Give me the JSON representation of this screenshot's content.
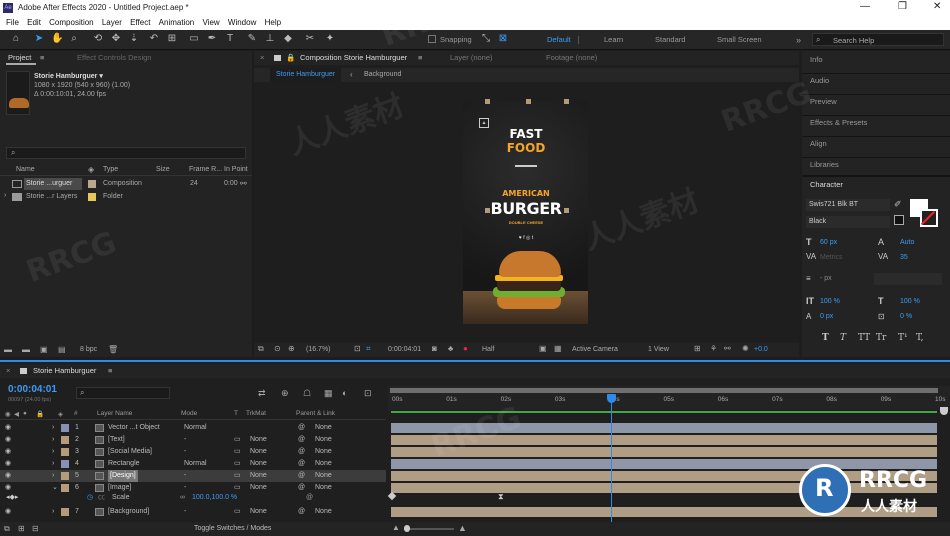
{
  "window": {
    "title": "Adobe After Effects 2020 - Untitled Project.aep *"
  },
  "menu": [
    "File",
    "Edit",
    "Composition",
    "Layer",
    "Effect",
    "Animation",
    "View",
    "Window",
    "Help"
  ],
  "toolbar": {
    "snapping": "Snapping",
    "workspaces": [
      "Default",
      "Learn",
      "Standard",
      "Small Screen"
    ],
    "search_placeholder": "Search Help"
  },
  "project": {
    "tab": "Project",
    "effect_tab": "Effect Controls Design",
    "comp_name": "Storie Hamburguer ▾",
    "comp_size": "1080 x 1920  (540 x 960) (1.00)",
    "comp_dur": "Δ 0:00:10:01, 24.00 fps",
    "search_placeholder": "",
    "columns": [
      "Name",
      "Type",
      "Size",
      "Frame R...",
      "In Point"
    ],
    "items": [
      {
        "name": "Storie ...urguer",
        "type": "Composition",
        "size": "",
        "fps": "24",
        "in": "0:00",
        "color": "#b9a98a"
      },
      {
        "name": "Storie ...r Layers",
        "type": "Folder",
        "size": "",
        "fps": "",
        "in": "",
        "color": "#e6c75a"
      }
    ],
    "bpc": "8 bpc"
  },
  "viewer": {
    "tab": "Composition Storie Hamburguer",
    "layer_tab": "Layer  (none)",
    "footage_tab": "Footage  (none)",
    "crumbs": [
      "Storie Hamburguer",
      "Background"
    ],
    "zoom": "(16.7%)",
    "time": "0:00:04:01",
    "res": "Half",
    "camera": "Active Camera",
    "views": "1 View",
    "exposure": "+0.0"
  },
  "poster": {
    "line1": "FAST",
    "line2": "FOOD",
    "line3": "AMERICAN",
    "line4": "BURGER",
    "line5": "DOUBLE CHEESE",
    "social": "♥ f ◎ t"
  },
  "right": {
    "items": [
      "Info",
      "Audio",
      "Preview",
      "Effects & Presets",
      "Align",
      "Libraries"
    ],
    "character_tab": "Character",
    "font": "Swis721 Blk BT",
    "style": "Black",
    "size": "60 px",
    "leading": "Auto",
    "kerning": "Metrics",
    "tracking": "35",
    "stroke": "- px",
    "vscale": "100 %",
    "hscale": "100 %",
    "baseline": "0 px",
    "tsume": "0 %",
    "styles": [
      "T",
      "T",
      "TT",
      "Tr",
      "T¹",
      "T,"
    ]
  },
  "timeline": {
    "tab": "Storie Hamburguer",
    "time": "0:00:04:01",
    "frames": "00097 (24.00 fps)",
    "headers": [
      "Layer Name",
      "Mode",
      "T",
      "TrkMat",
      "Parent & Link"
    ],
    "ruler": [
      "00s",
      "01s",
      "02s",
      "03s",
      "04s",
      "05s",
      "06s",
      "07s",
      "08s",
      "09s",
      "10s"
    ],
    "toggle": "Toggle Switches / Modes",
    "layers": [
      {
        "n": "1",
        "name": "Vector ...t Object",
        "mode": "Normal",
        "trk": "",
        "parent": "None",
        "color": "#8a8fb5",
        "bar": "#8f96a8"
      },
      {
        "n": "2",
        "name": "[Text]",
        "mode": "-",
        "trk": "None",
        "parent": "None",
        "color": "#b59a7c",
        "bar": "#b09d86"
      },
      {
        "n": "3",
        "name": "[Social Media]",
        "mode": "-",
        "trk": "None",
        "parent": "None",
        "color": "#b59a7c",
        "bar": "#b09d86"
      },
      {
        "n": "4",
        "name": "Rectangle",
        "mode": "Normal",
        "trk": "None",
        "parent": "None",
        "color": "#8a8fb5",
        "bar": "#8f96a8"
      },
      {
        "n": "5",
        "name": "[Design]",
        "mode": "-",
        "trk": "None",
        "parent": "None",
        "color": "#b59a7c",
        "bar": "#b09d86"
      },
      {
        "n": "6",
        "name": "[Image]",
        "mode": "-",
        "trk": "None",
        "parent": "None",
        "color": "#b59a7c",
        "bar": "#b09d86"
      },
      {
        "n": "7",
        "name": "[Background]",
        "mode": "-",
        "trk": "None",
        "parent": "None",
        "color": "#b59a7c",
        "bar": "#b09d86"
      }
    ],
    "scale_label": "Scale",
    "scale_value": "100.0,100.0 %"
  },
  "watermark": {
    "brand": "RRCG",
    "sub": "人人素材",
    "wm": "RRCG",
    "wm2": "人人素材"
  },
  "colors": {
    "accent": "#2d8ceb",
    "timecode": "#3b9cf5",
    "playhead": "#2d8ceb"
  }
}
